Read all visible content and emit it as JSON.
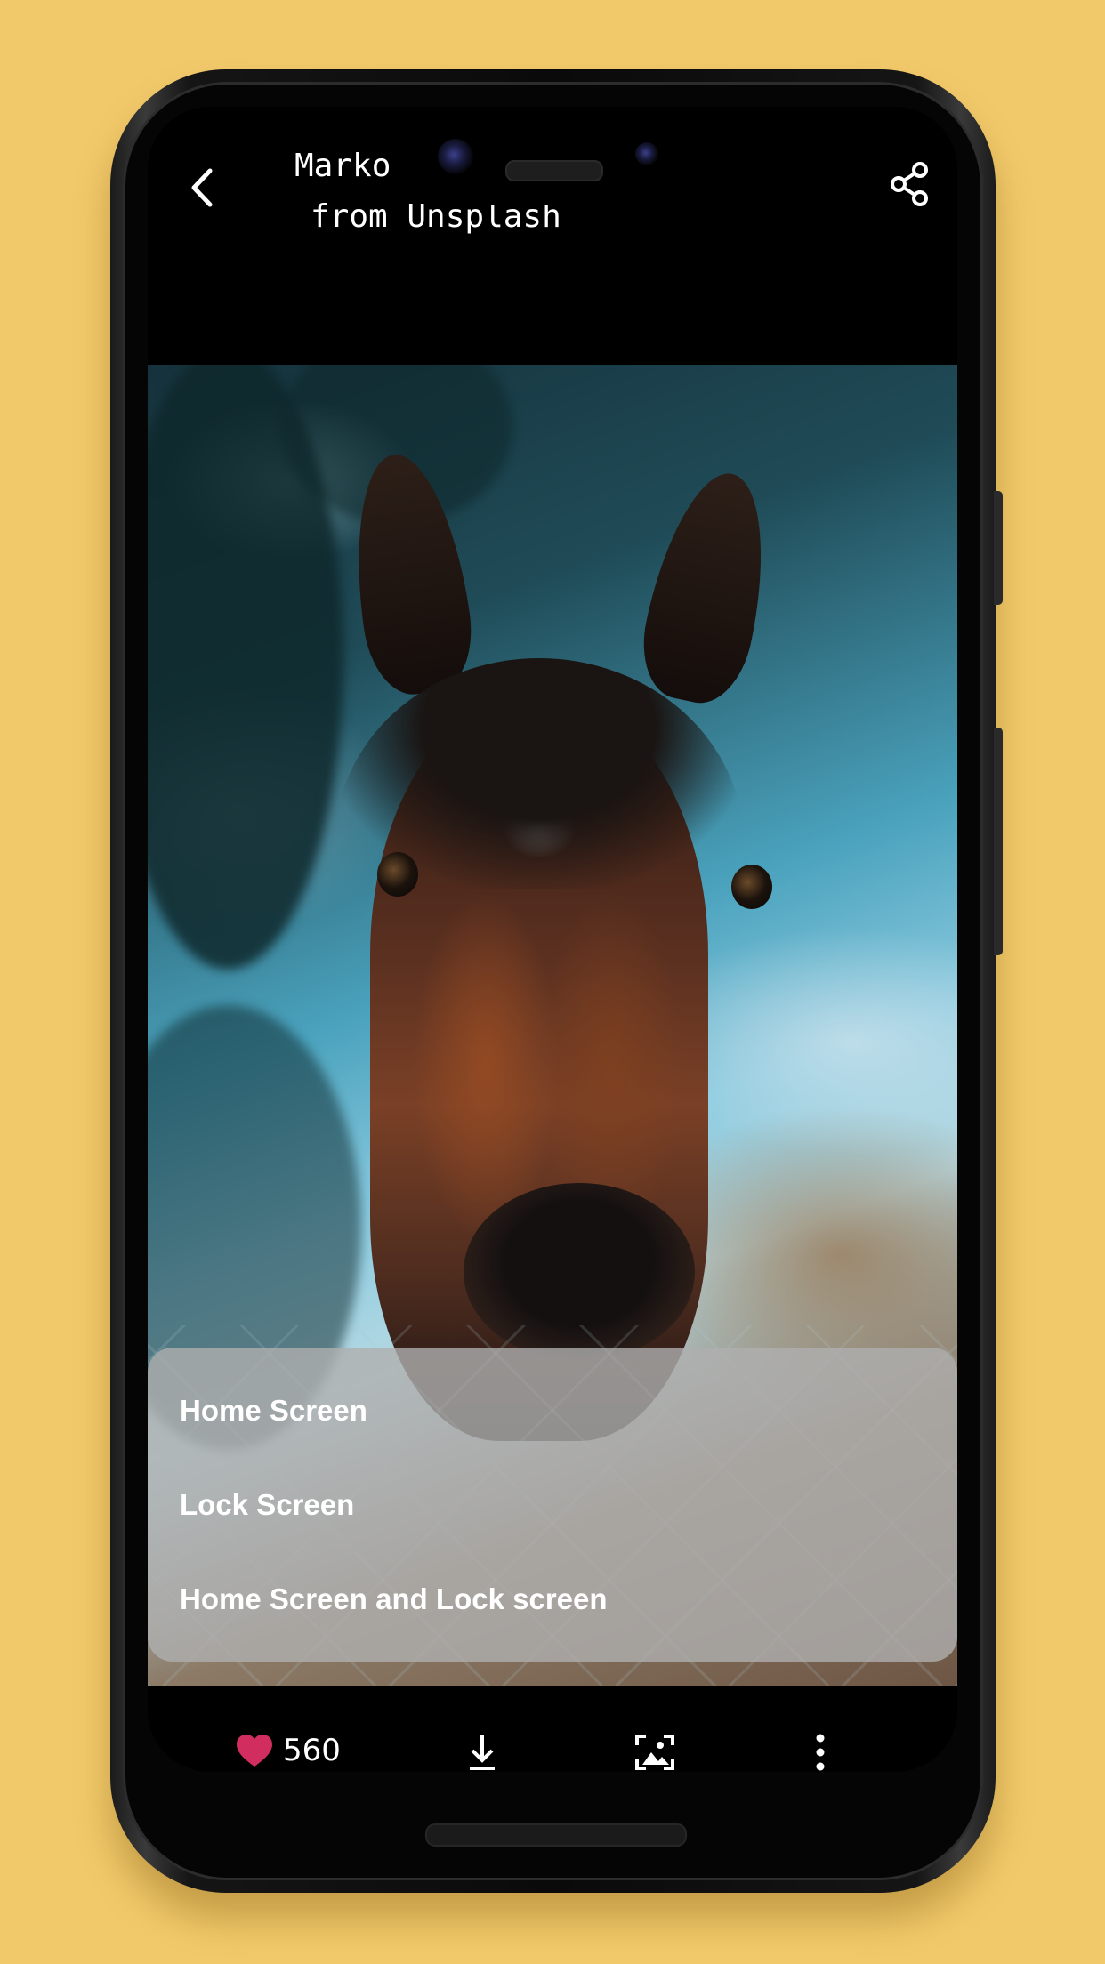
{
  "header": {
    "title_line1": "Marko",
    "title_line2": "from Unsplash"
  },
  "wallpaper_menu": {
    "items": [
      {
        "label": "Home Screen"
      },
      {
        "label": "Lock Screen"
      },
      {
        "label": "Home Screen and Lock screen"
      }
    ]
  },
  "bottom_bar": {
    "like_count": "560",
    "icons": [
      "heart-icon",
      "download-icon",
      "set-wallpaper-icon",
      "more-vert-icon"
    ]
  },
  "colors": {
    "background": "#f1c96a",
    "like": "#d12d5f",
    "sheet": "rgba(175,175,175,0.80)"
  }
}
